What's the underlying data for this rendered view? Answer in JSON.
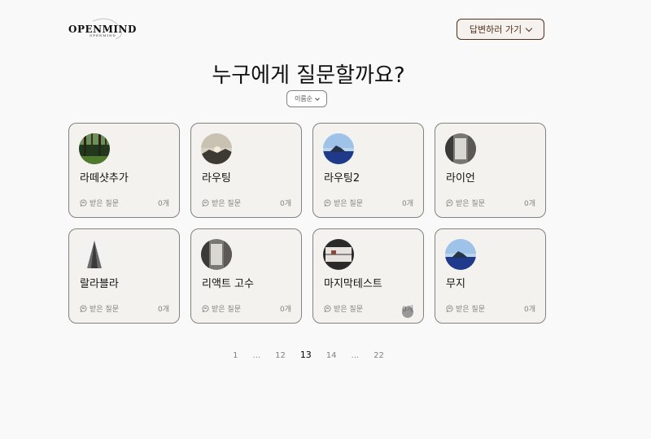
{
  "header": {
    "logo_text": "OPENMIND",
    "logo_sub": "OPENMIND",
    "answer_button_label": "답변하러 가기"
  },
  "main": {
    "title": "누구에게 질문할까요?",
    "sort_label": "이름순"
  },
  "cards": [
    {
      "name": "라떼샷추가",
      "received_label": "받은 질문",
      "count": "0개",
      "avatar": "forest"
    },
    {
      "name": "라우팅",
      "received_label": "받은 질문",
      "count": "0개",
      "avatar": "sunset"
    },
    {
      "name": "라우팅2",
      "received_label": "받은 질문",
      "count": "0개",
      "avatar": "island"
    },
    {
      "name": "라이언",
      "received_label": "받은 질문",
      "count": "0개",
      "avatar": "room"
    },
    {
      "name": "랄라블라",
      "received_label": "받은 질문",
      "count": "0개",
      "avatar": "building"
    },
    {
      "name": "리액트 고수",
      "received_label": "받은 질문",
      "count": "0개",
      "avatar": "room"
    },
    {
      "name": "마지막테스트",
      "received_label": "받은 질문",
      "count": "0개",
      "avatar": "window"
    },
    {
      "name": "무지",
      "received_label": "받은 질문",
      "count": "0개",
      "avatar": "island"
    }
  ],
  "pagination": {
    "items": [
      "1",
      "...",
      "12",
      "13",
      "14",
      "...",
      "22"
    ],
    "current": "13"
  },
  "colors": {
    "brown": "#542f1a",
    "card_bg": "#f4f2ef",
    "grey": "#818181"
  }
}
